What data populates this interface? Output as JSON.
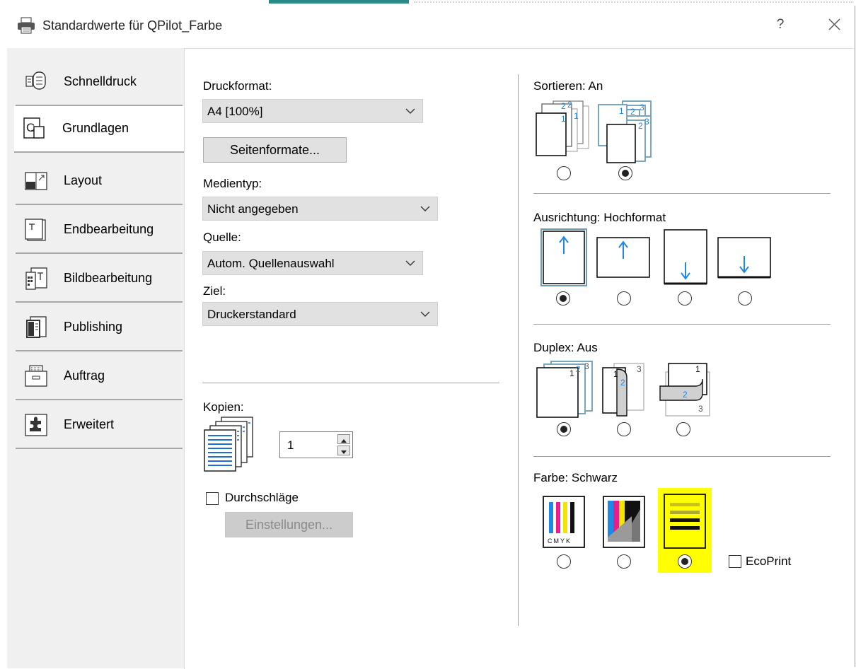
{
  "window": {
    "title": "Standardwerte für QPilot_Farbe",
    "help_label": "?"
  },
  "tabs": [
    {
      "label": "Schnelldruck",
      "active": false
    },
    {
      "label": "Grundlagen",
      "active": true
    },
    {
      "label": "Layout",
      "active": false
    },
    {
      "label": "Endbearbeitung",
      "active": false
    },
    {
      "label": "Bildbearbeitung",
      "active": false
    },
    {
      "label": "Publishing",
      "active": false
    },
    {
      "label": "Auftrag",
      "active": false
    },
    {
      "label": "Erweitert",
      "active": false
    }
  ],
  "left": {
    "druckformat": {
      "label": "Druckformat:",
      "value": "A4  [100%]"
    },
    "seitenformate_button": "Seitenformate...",
    "medientyp": {
      "label": "Medientyp:",
      "value": "Nicht angegeben"
    },
    "quelle": {
      "label": "Quelle:",
      "value": "Autom. Quellenauswahl"
    },
    "ziel": {
      "label": "Ziel:",
      "value": "Druckerstandard"
    },
    "kopien": {
      "label": "Kopien:",
      "value": "1"
    },
    "durchschlaege": {
      "label": "Durchschläge",
      "checked": false
    },
    "einstellungen_button": "Einstellungen..."
  },
  "right": {
    "sortieren": {
      "label": "Sortieren:",
      "value": "An",
      "selected_index": 1,
      "options": 2
    },
    "ausrichtung": {
      "label": "Ausrichtung:",
      "value": "Hochformat",
      "selected_index": 0,
      "options": 4
    },
    "duplex": {
      "label": "Duplex:",
      "value": "Aus",
      "selected_index": 0,
      "options": 3
    },
    "farbe": {
      "label": "Farbe:",
      "value": "Schwarz",
      "selected_index": 2,
      "options": 3,
      "highlight_color": "#ffff00"
    },
    "ecoprint": {
      "label": "EcoPrint",
      "checked": false
    }
  },
  "icon_text": {
    "collate_off_numbers": [
      "2",
      "2",
      "1",
      "1"
    ],
    "collate_on_numbers": [
      "1",
      "2",
      "3",
      "2",
      "3"
    ],
    "duplex_numbers": [
      "1",
      "2",
      "3"
    ],
    "cmyk": "CMYK"
  },
  "colors": {
    "accent_blue": "#1e88e5",
    "title_accent": "#2a8a86",
    "highlight": "#ffff00"
  }
}
